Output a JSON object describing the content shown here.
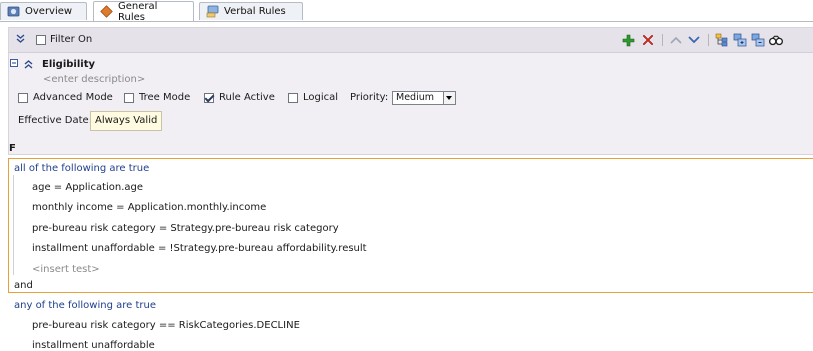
{
  "tabs": [
    {
      "label": "Overview",
      "icon": "overview-icon"
    },
    {
      "label": "General Rules",
      "icon": "general-rules-icon"
    },
    {
      "label": "Verbal Rules",
      "icon": "verbal-rules-icon"
    }
  ],
  "toolbar": {
    "filter_label": "Filter On",
    "filter_checked": false,
    "icons": [
      "add-icon",
      "delete-icon",
      "move-up-icon",
      "move-down-icon",
      "tree-icon",
      "expand-icon",
      "collapse-icon",
      "find-icon"
    ]
  },
  "rule": {
    "name": "Eligibility",
    "description_placeholder": "<enter description>",
    "advanced_mode_label": "Advanced Mode",
    "tree_mode_label": "Tree Mode",
    "rule_active_label": "Rule Active",
    "logical_label": "Logical",
    "priority_label": "Priority:",
    "priority_value": "Medium",
    "effective_date_label": "Effective Date:",
    "effective_date_value": "Always Valid",
    "checks": {
      "advanced_mode": false,
      "tree_mode": false,
      "rule_active": true,
      "logical": false
    }
  },
  "if_section": {
    "label": "F",
    "group1_header": "all of the following are true",
    "group1_tests": [
      "age = Application.age",
      "monthly income = Application.monthly.income",
      "pre-bureau risk category = Strategy.pre-bureau risk category",
      "installment unaffordable = !Strategy.pre-bureau affordability.result"
    ],
    "insert_test": "<insert test>",
    "connector": "and",
    "group2_header": "any of the following are true",
    "group2_tests": [
      "pre-bureau risk category  ==  RiskCategories.DECLINE",
      "installment unaffordable"
    ]
  },
  "colors": {
    "group_border": "#e8a13a",
    "header_blue": "#1f3f8f",
    "panel_bg": "#f1eff4"
  }
}
